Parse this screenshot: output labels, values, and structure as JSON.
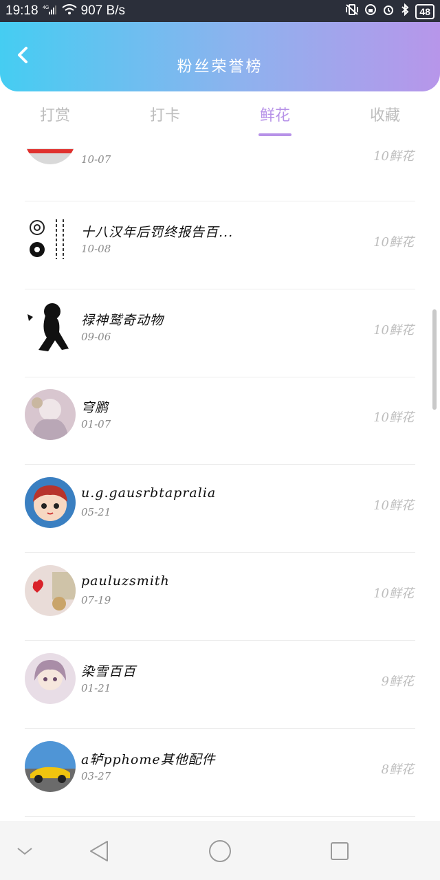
{
  "status_bar": {
    "time": "19:18",
    "network": "4G",
    "speed": "907 B/s",
    "battery": "48"
  },
  "header": {
    "title": "粉丝荣誉榜",
    "back_icon": "chevron-left-icon"
  },
  "tabs": [
    {
      "label": "打赏",
      "active": false
    },
    {
      "label": "打卡",
      "active": false
    },
    {
      "label": "鲜花",
      "active": true
    },
    {
      "label": "收藏",
      "active": false
    }
  ],
  "colors": {
    "accent": "#b792e8",
    "header_gradient_start": "#45cdf2",
    "header_gradient_end": "#b796ea"
  },
  "fans": [
    {
      "name": "",
      "date": "10-07",
      "count": "10鲜花",
      "avatar": "partial-avatar"
    },
    {
      "name": "十八汉年后罚终报告百...",
      "date": "10-08",
      "count": "10鲜花",
      "avatar": "flower-text-avatar"
    },
    {
      "name": "禄神鹫奇动物",
      "date": "09-06",
      "count": "10鲜花",
      "avatar": "silhouette-avatar"
    },
    {
      "name": "穹鹏",
      "date": "01-07",
      "count": "10鲜花",
      "avatar": "anime-girl-avatar"
    },
    {
      "name": "u.g.gausrbtapralia",
      "date": "05-21",
      "count": "10鲜花",
      "avatar": "cartoon-face-avatar"
    },
    {
      "name": "pauluzsmith",
      "date": "07-19",
      "count": "10鲜花",
      "avatar": "heart-photo-avatar"
    },
    {
      "name": "染雪百百",
      "date": "01-21",
      "count": "9鲜花",
      "avatar": "anime-girl-avatar"
    },
    {
      "name": "a轳pphome其他配件",
      "date": "03-27",
      "count": "8鲜花",
      "avatar": "yellow-car-avatar"
    }
  ],
  "nav_bar": {
    "buttons": [
      "chevron-down-icon",
      "back-triangle-icon",
      "home-circle-icon",
      "recents-square-icon"
    ]
  }
}
